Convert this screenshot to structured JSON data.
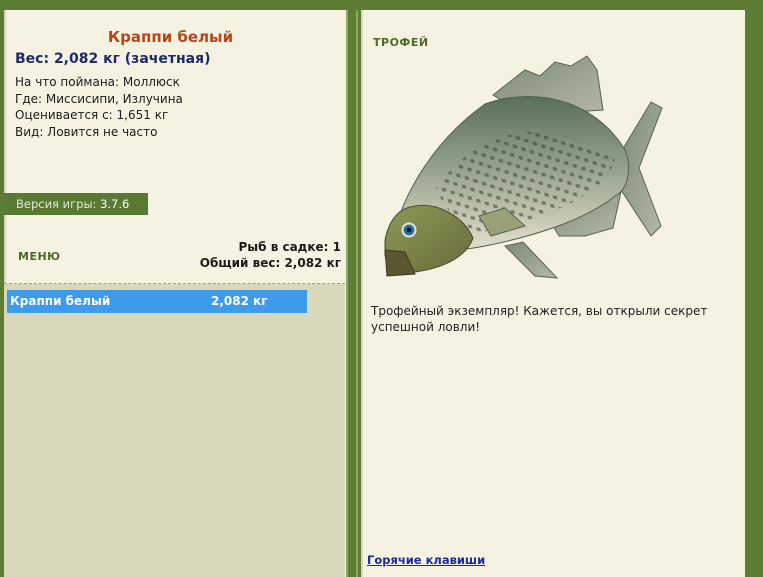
{
  "fish": {
    "name": "Краппи белый",
    "weight_line": "Вес: 2,082 кг (зачетная)",
    "bait": "На что поймана: Моллюск",
    "location": "Где: Миссисипи, Излучина",
    "value": "Оценивается с: 1,651 кг",
    "rarity": "Вид: Ловится не часто"
  },
  "version": {
    "label": "Версия игры:",
    "number": "3.7.6"
  },
  "menu": {
    "label": "МЕНЮ"
  },
  "keepnet": {
    "count": "Рыб в садке: 1",
    "total_weight": "Общий вес: 2,082 кг"
  },
  "catch_list": [
    {
      "name": "Краппи белый",
      "weight": "2,082 кг"
    }
  ],
  "trophy": {
    "label": "ТРОФЕЙ",
    "description": "Трофейный экземпляр! Кажется, вы открыли секрет успешной ловли!"
  },
  "hotkeys": {
    "label": "Горячие клавиши"
  },
  "colors": {
    "frame": "#5d7d35",
    "panel": "#f5f2e2",
    "title": "#b6471c",
    "selected": "#3d9bea"
  }
}
